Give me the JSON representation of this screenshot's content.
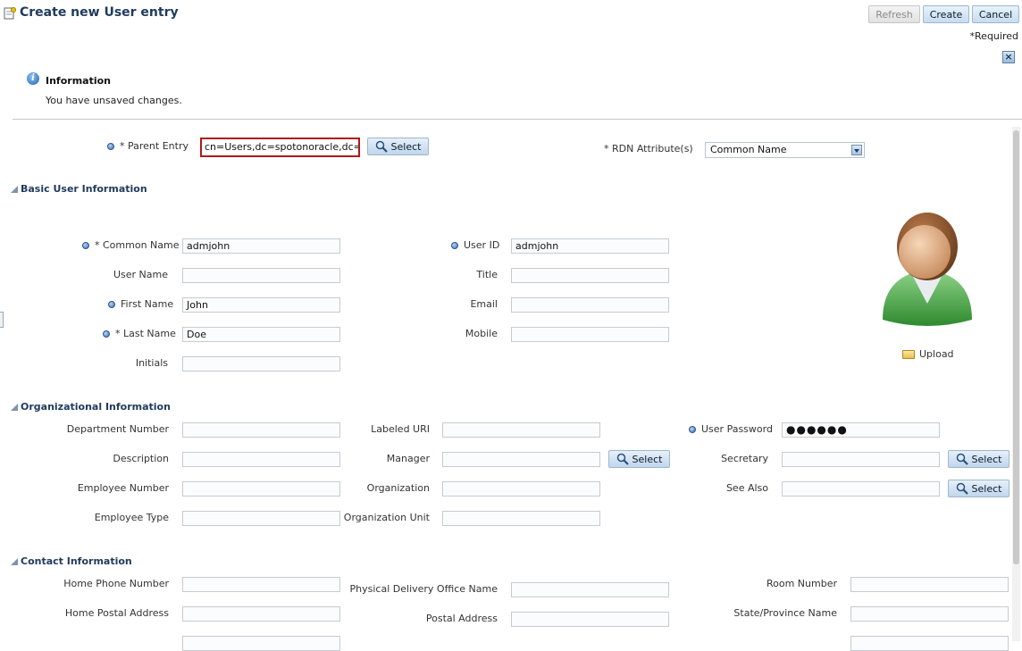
{
  "header": {
    "title": "Create new User entry",
    "refresh_label": "Refresh",
    "create_label": "Create",
    "cancel_label": "Cancel",
    "required_note": "*Required"
  },
  "info": {
    "title": "Information",
    "message": "You have unsaved changes."
  },
  "parent": {
    "label": "* Parent Entry",
    "value": "cn=Users,dc=spotonoracle,dc=ch",
    "select_label": "Select",
    "rdn_label": "* RDN Attribute(s)",
    "rdn_value": "Common Name"
  },
  "basic": {
    "heading": "Basic User Information",
    "common_name_label": "* Common Name",
    "common_name_value": "admjohn",
    "user_name_label": "User Name",
    "user_name_value": "",
    "first_name_label": "First Name",
    "first_name_value": "John",
    "last_name_label": "* Last Name",
    "last_name_value": "Doe",
    "initials_label": "Initials",
    "initials_value": "",
    "user_id_label": "User ID",
    "user_id_value": "admjohn",
    "title_label": "Title",
    "title_value": "",
    "email_label": "Email",
    "email_value": "",
    "mobile_label": "Mobile",
    "mobile_value": "",
    "upload_label": "Upload"
  },
  "org": {
    "heading": "Organizational Information",
    "dept_label": "Department Number",
    "desc_label": "Description",
    "empnum_label": "Employee Number",
    "emptype_label": "Employee Type",
    "uri_label": "Labeled URI",
    "manager_label": "Manager",
    "org_label": "Organization",
    "orgunit_label": "Organization Unit",
    "password_label": "User Password",
    "password_value": "●●●●●●",
    "secretary_label": "Secretary",
    "seealso_label": "See Also",
    "select_label": "Select"
  },
  "contact": {
    "heading": "Contact Information",
    "home_phone_label": "Home Phone Number",
    "home_postal_label": "Home Postal Address",
    "pdo_label": "Physical Delivery Office Name",
    "postal_label": "Postal Address",
    "room_label": "Room Number",
    "state_label": "State/Province Name"
  },
  "colors": {
    "accent": "#1f3a5c",
    "error_border": "#b0161b",
    "button_bg": "#c7dcef"
  }
}
